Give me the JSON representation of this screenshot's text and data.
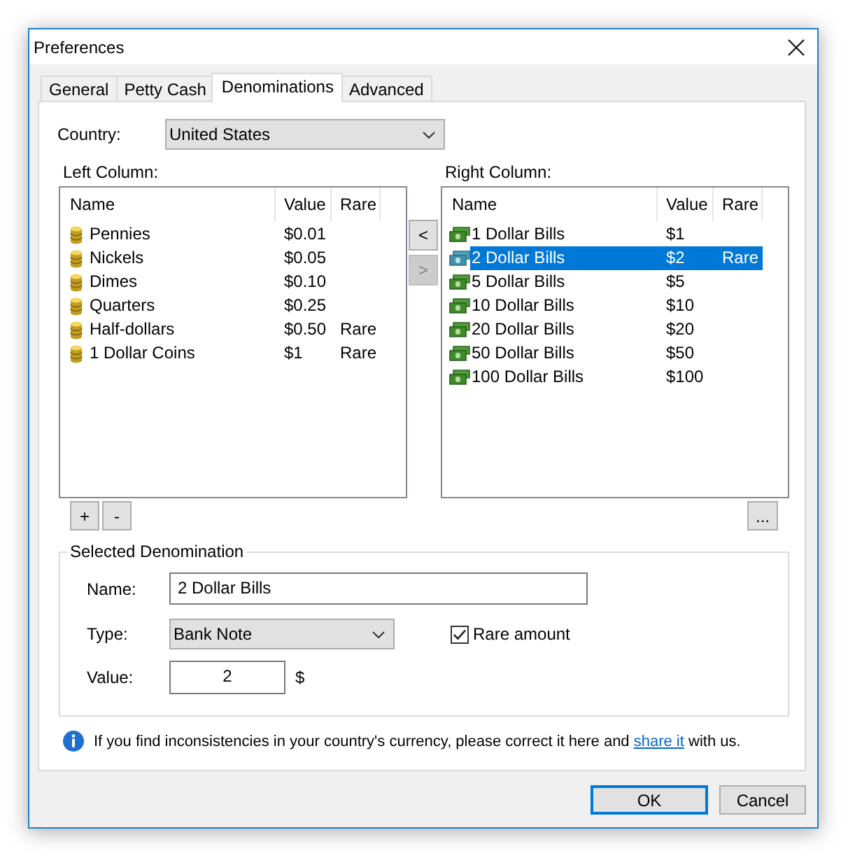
{
  "window": {
    "title": "Preferences"
  },
  "tabs": [
    {
      "label": "General",
      "selected": false
    },
    {
      "label": "Petty Cash",
      "selected": false
    },
    {
      "label": "Denominations",
      "selected": true
    },
    {
      "label": "Advanced",
      "selected": false
    }
  ],
  "country": {
    "label": "Country:",
    "value": "United States"
  },
  "left_column": {
    "label": "Left Column:",
    "columns": [
      "Name",
      "Value",
      "Rare"
    ],
    "rows": [
      {
        "name": "Pennies",
        "value": "$0.01",
        "selected": false
      },
      {
        "name": "Nickels",
        "value": "$0.05",
        "selected": false
      },
      {
        "name": "Dimes",
        "value": "$0.10",
        "selected": false
      },
      {
        "name": "Quarters",
        "value": "$0.25",
        "selected": false
      },
      {
        "name": "Half-dollars",
        "value": "$0.50",
        "rare": "Rare",
        "selected": false
      },
      {
        "name": "1 Dollar Coins",
        "value": "$1",
        "rare": "Rare",
        "selected": false
      }
    ]
  },
  "move_buttons": [
    {
      "label": "<",
      "disabled": false
    },
    {
      "label": ">",
      "disabled": true
    }
  ],
  "right_column": {
    "label": "Right Column:",
    "columns": [
      "Name",
      "Value",
      "Rare"
    ],
    "rows": [
      {
        "name": "1 Dollar Bills",
        "value": "$1",
        "selected": false
      },
      {
        "name": "2 Dollar Bills",
        "value": "$2",
        "rare": "Rare",
        "selected": true
      },
      {
        "name": "5 Dollar Bills",
        "value": "$5",
        "selected": false
      },
      {
        "name": "10 Dollar Bills",
        "value": "$10",
        "selected": false
      },
      {
        "name": "20 Dollar Bills",
        "value": "$20",
        "selected": false
      },
      {
        "name": "50 Dollar Bills",
        "value": "$50",
        "selected": false
      },
      {
        "name": "100 Dollar Bills",
        "value": "$100",
        "selected": false
      }
    ]
  },
  "list_buttons": [
    {
      "label": "+"
    },
    {
      "label": "-"
    }
  ],
  "more_button": {
    "label": "..."
  },
  "selected_denomination": {
    "title": "Selected Denomination",
    "name": {
      "label": "Name:",
      "value": "2 Dollar Bills"
    },
    "type": {
      "label": "Type:",
      "value": "Bank Note"
    },
    "rare": {
      "label": "Rare amount",
      "checked": true
    },
    "value": {
      "label": "Value:",
      "value": "2",
      "unit": "$"
    }
  },
  "info": {
    "text_before": "If you find inconsistencies in your country's currency, please correct it here and ",
    "link": "share it",
    "text_after": " with us."
  },
  "buttons": [
    {
      "label": "OK",
      "default": true
    },
    {
      "label": "Cancel",
      "default": false
    }
  ]
}
